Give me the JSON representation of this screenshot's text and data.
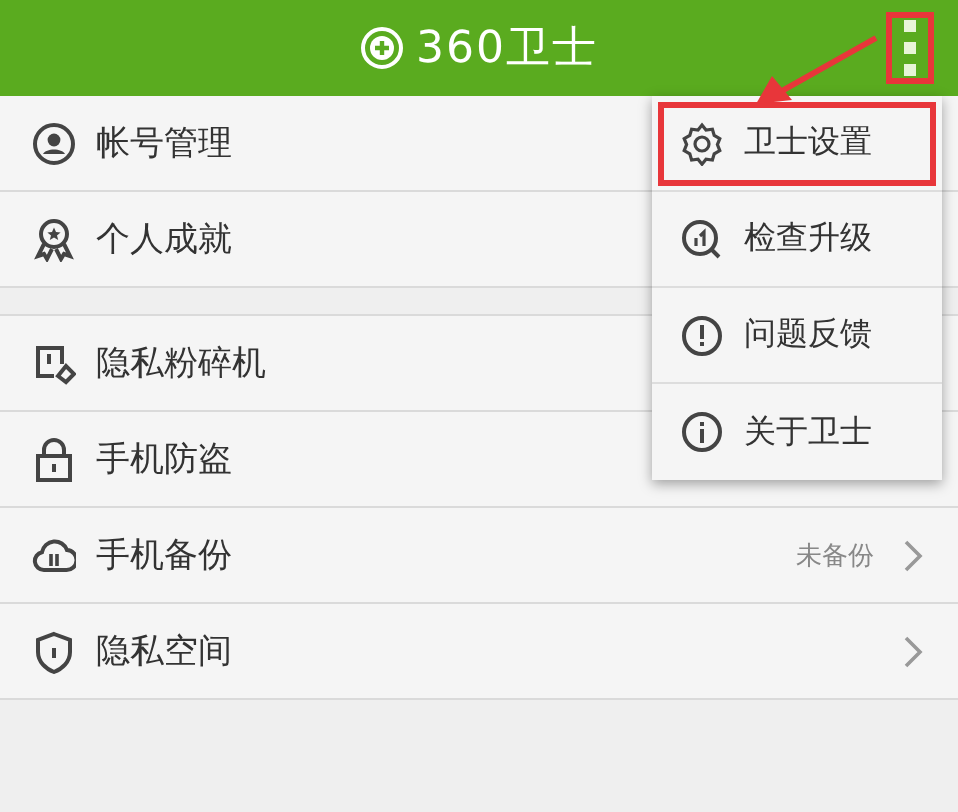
{
  "header": {
    "title": "360卫士",
    "menu_button": {
      "annotated": true
    }
  },
  "groups": [
    {
      "rows": [
        {
          "kind": "account",
          "label": "帐号管理"
        },
        {
          "kind": "award",
          "label": "个人成就"
        }
      ]
    },
    {
      "rows": [
        {
          "kind": "shredder",
          "label": "隐私粉碎机"
        },
        {
          "kind": "lock",
          "label": "手机防盗"
        },
        {
          "kind": "cloud",
          "label": "手机备份",
          "status": "未备份",
          "chevron": true
        },
        {
          "kind": "shield",
          "label": "隐私空间",
          "chevron": true
        }
      ]
    }
  ],
  "menu": [
    {
      "kind": "gear",
      "label": "卫士设置",
      "annotated": true
    },
    {
      "kind": "upgrade",
      "label": "检查升级",
      "annotated": false
    },
    {
      "kind": "alert",
      "label": "问题反馈",
      "annotated": false
    },
    {
      "kind": "info",
      "label": "关于卫士",
      "annotated": false
    }
  ]
}
